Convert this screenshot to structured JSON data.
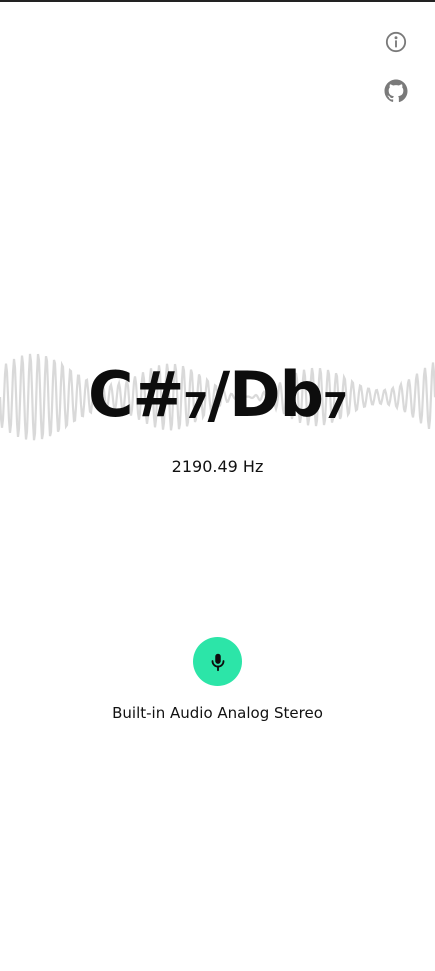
{
  "icons": {
    "info": "info-icon",
    "github": "github-icon",
    "mic": "microphone-icon"
  },
  "note": {
    "first_name": "C#",
    "first_octave": "7",
    "separator": "/",
    "second_name": "Db",
    "second_octave": "7"
  },
  "frequency": "2190.49 Hz",
  "device_label": "Built-in Audio Analog Stereo",
  "colors": {
    "accent": "#2ce5a8",
    "waveform": "#d9d9d9",
    "icon": "#7a7a7a"
  }
}
